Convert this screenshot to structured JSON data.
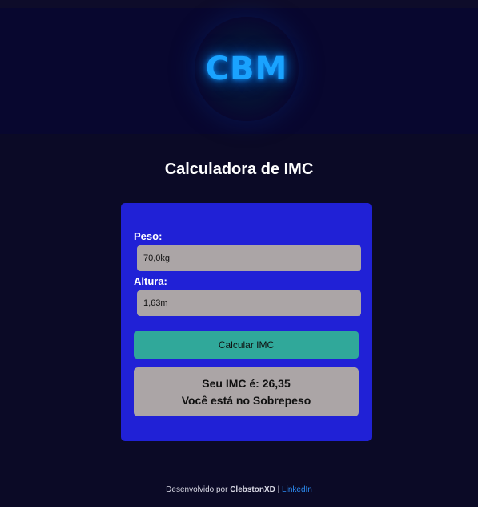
{
  "logo": {
    "text": "CBM"
  },
  "page": {
    "title": "Calculadora de IMC"
  },
  "form": {
    "peso_label": "Peso:",
    "peso_value": "70,0kg",
    "altura_label": "Altura:",
    "altura_value": "1,63m",
    "calc_button_label": "Calcular IMC"
  },
  "result": {
    "imc_line": "Seu IMC é: 26,35",
    "status_line": "Você está no Sobrepeso"
  },
  "footer": {
    "prefix": "Desenvolvido por ",
    "author": "ClebstonXD",
    "separator": " | ",
    "link_label": "LinkedIn"
  },
  "colors": {
    "page_background": "#0b0a26",
    "header_background": "#08072f",
    "card_background": "#2021d6",
    "input_background": "#aba5a6",
    "button_background": "#30a89a",
    "logo_color": "#1aa3ff",
    "link_color": "#2c8cf2"
  }
}
